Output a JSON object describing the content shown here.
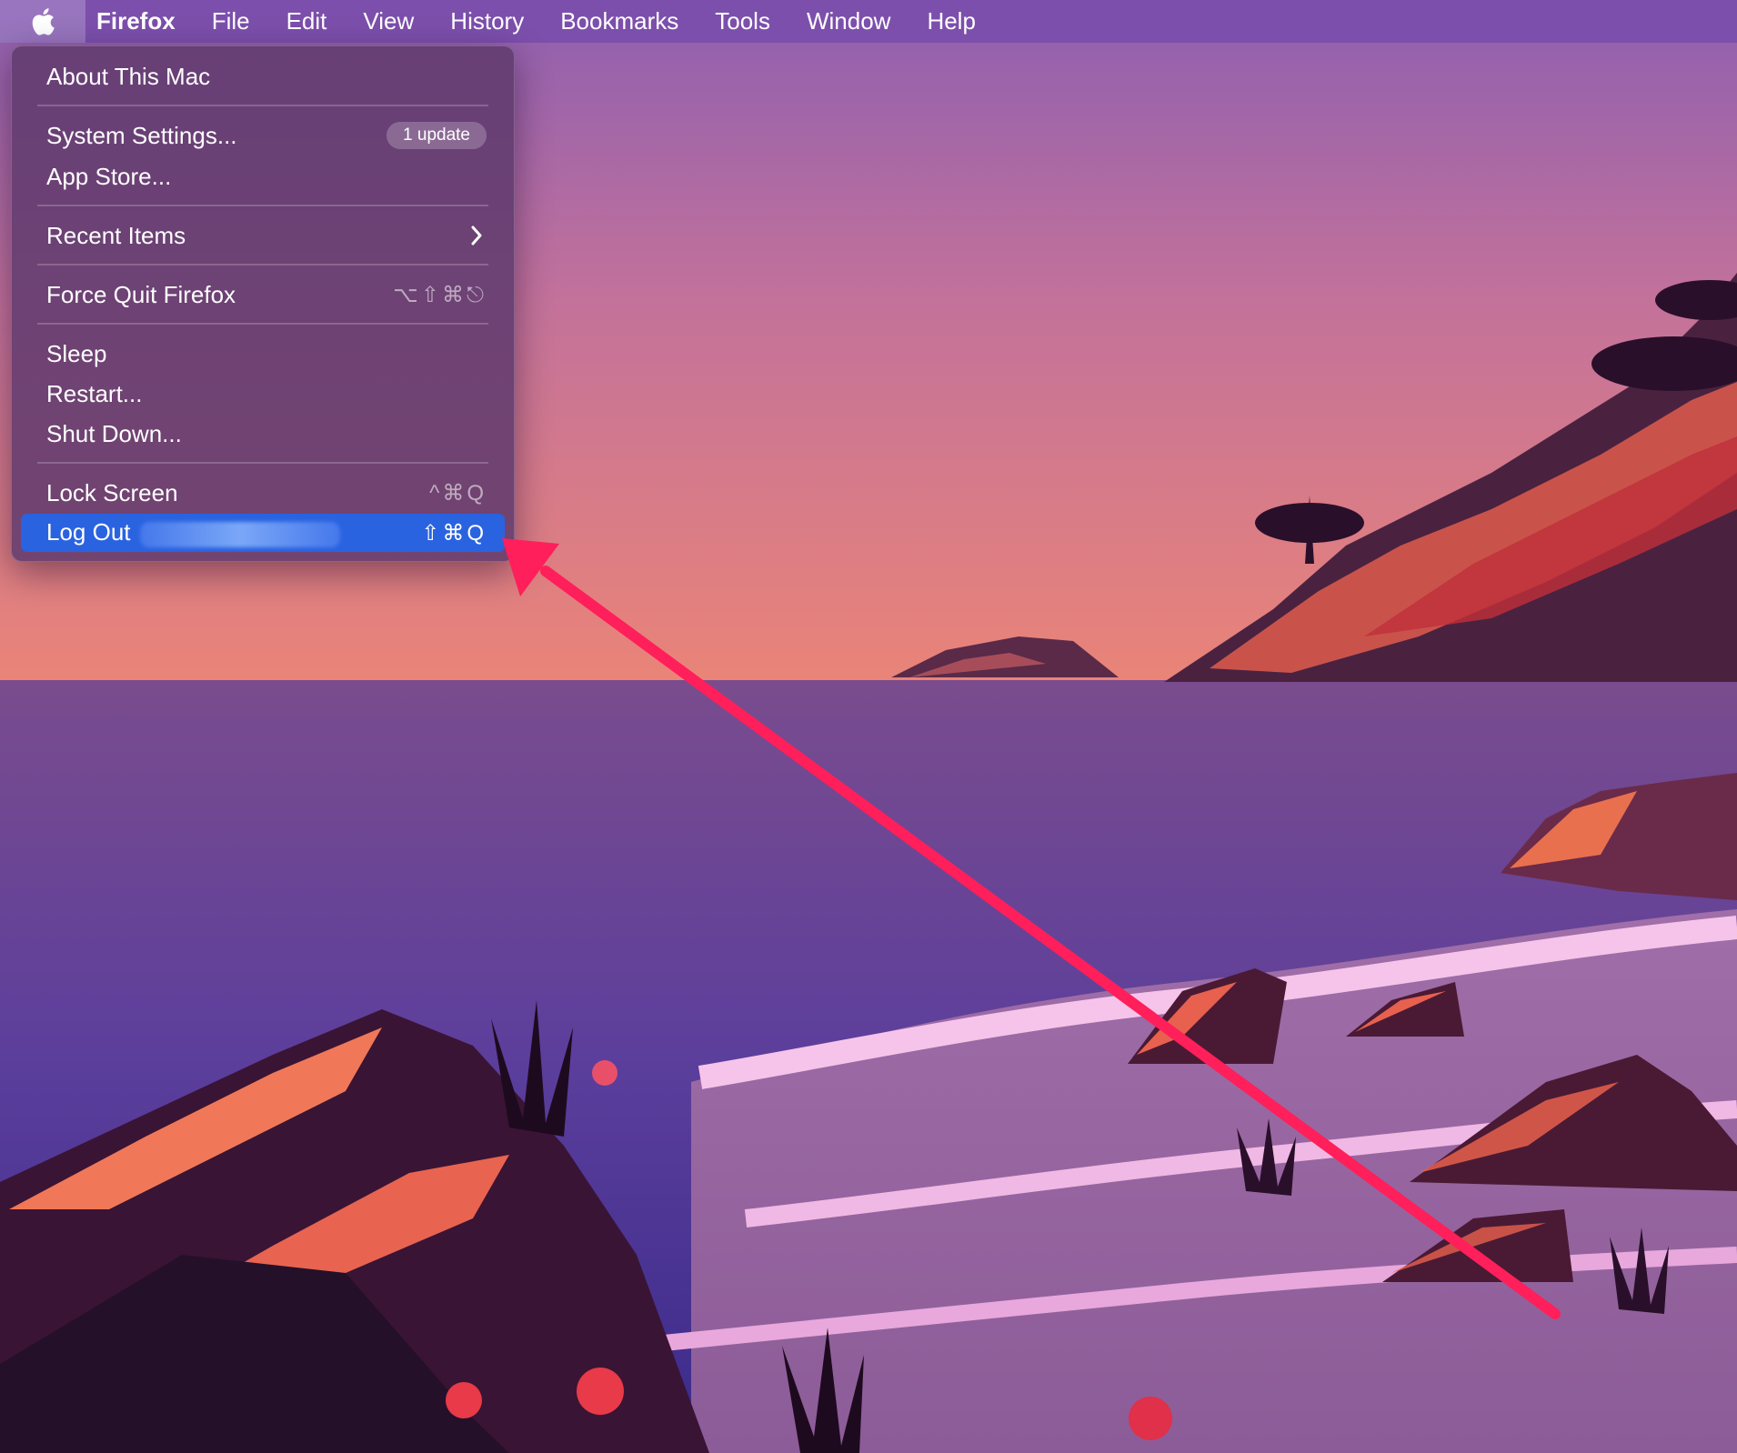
{
  "menubar": {
    "apple_icon": "apple-logo-icon",
    "app_name": "Firefox",
    "items": [
      "File",
      "Edit",
      "View",
      "History",
      "Bookmarks",
      "Tools",
      "Window",
      "Help"
    ]
  },
  "apple_menu": {
    "about": "About This Mac",
    "system_settings": "System Settings...",
    "system_settings_badge": "1 update",
    "app_store": "App Store...",
    "recent_items": "Recent Items",
    "recent_items_icon": "chevron-right-icon",
    "force_quit": "Force Quit Firefox",
    "force_quit_shortcut": "⌥⇧⌘⎋",
    "sleep": "Sleep",
    "restart": "Restart...",
    "shut_down": "Shut Down...",
    "lock_screen": "Lock Screen",
    "lock_screen_shortcut": "^⌘Q",
    "log_out": "Log Out",
    "log_out_shortcut": "⇧⌘Q"
  },
  "annotation": {
    "arrow_color": "#ff1f5a",
    "highlight_color": "#2a63e0"
  }
}
